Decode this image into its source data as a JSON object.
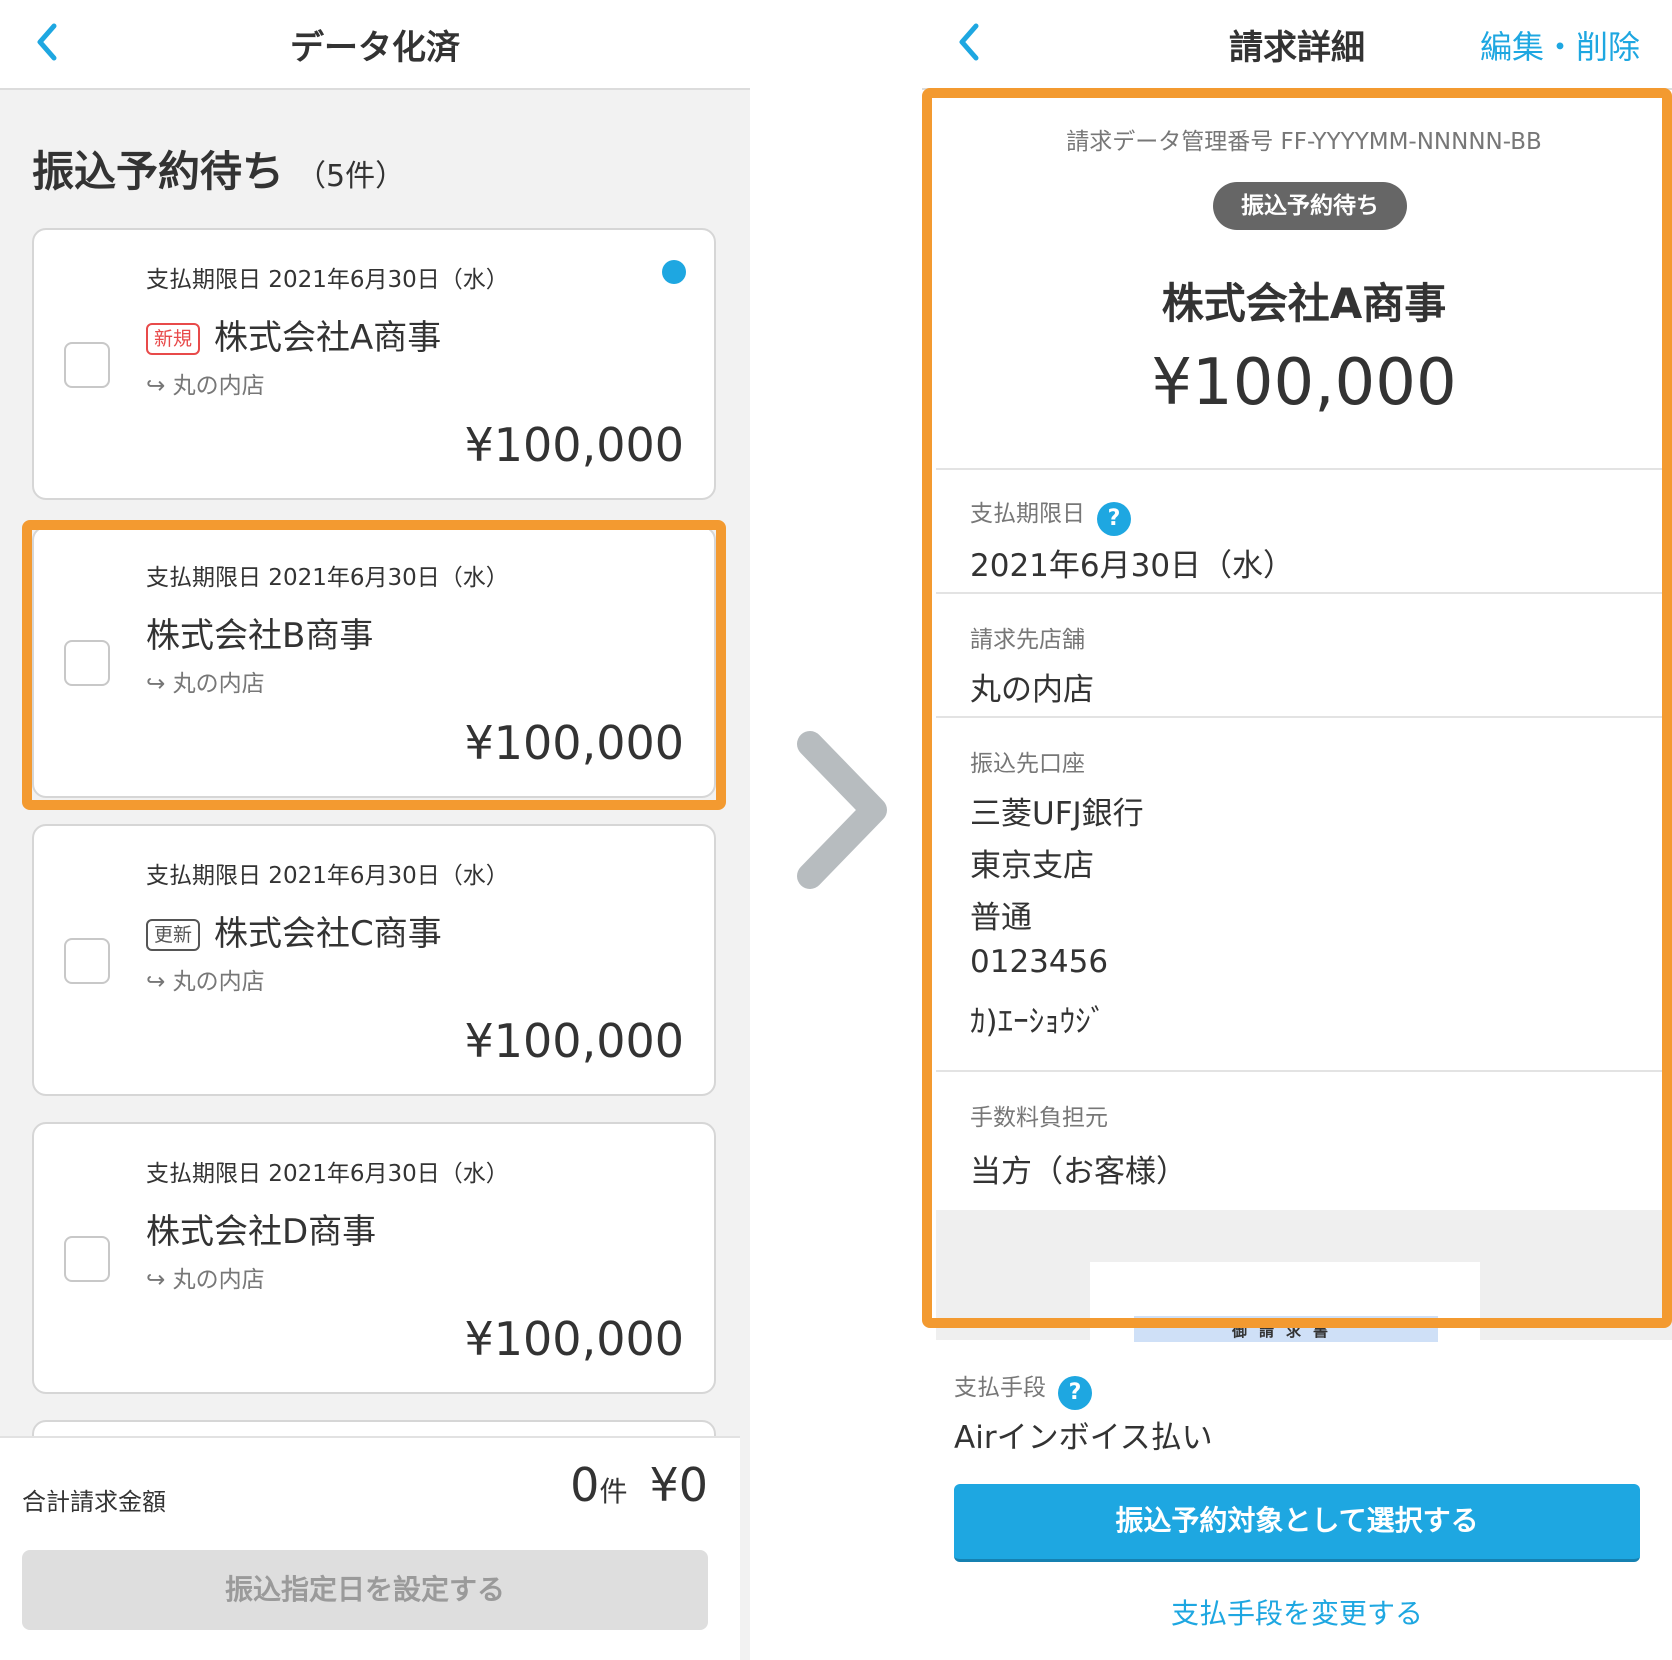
{
  "left": {
    "header_title": "データ化済",
    "section_title": "振込予約待ち",
    "section_count": "（5件）",
    "invoices": [
      {
        "due": "支払期限日 2021年6月30日（水）",
        "tag": "新規",
        "tag_type": "new",
        "company": "株式会社A商事",
        "branch": "丸の内店",
        "amount": "¥100,000",
        "unread": true
      },
      {
        "due": "支払期限日 2021年6月30日（水）",
        "tag": "",
        "tag_type": "",
        "company": "株式会社B商事",
        "branch": "丸の内店",
        "amount": "¥100,000",
        "unread": false
      },
      {
        "due": "支払期限日 2021年6月30日（水）",
        "tag": "更新",
        "tag_type": "upd",
        "company": "株式会社C商事",
        "branch": "丸の内店",
        "amount": "¥100,000",
        "unread": false
      },
      {
        "due": "支払期限日 2021年6月30日（水）",
        "tag": "",
        "tag_type": "",
        "company": "株式会社D商事",
        "branch": "丸の内店",
        "amount": "¥100,000",
        "unread": false
      }
    ],
    "footer": {
      "total_label": "合計請求金額",
      "total_count": "0",
      "total_count_unit": "件",
      "total_amount": "¥0",
      "button_label": "振込指定日を設定する"
    }
  },
  "right": {
    "header_title": "請求詳細",
    "edit_link": "編集・削除",
    "management_number": "請求データ管理番号 FF-YYYYMM-NNNNN-BB",
    "status": "振込予約待ち",
    "company": "株式会社A商事",
    "amount": "¥100,000",
    "fields": {
      "due_label": "支払期限日",
      "due_value": "2021年6月30日（水）",
      "store_label": "請求先店舗",
      "store_value": "丸の内店",
      "account_label": "振込先口座",
      "bank": "三菱UFJ銀行",
      "branch": "東京支店",
      "account_type": "普通",
      "account_number": "0123456",
      "account_holder": "ｶ)ｴｰｼｮｳｼﾞ",
      "fee_label": "手数料負担元",
      "fee_value": "当方（お客様）"
    },
    "preview_title": "御請求書",
    "payment_method_label": "支払手段",
    "payment_method_value": "Airインボイス払い",
    "primary_button": "振込予約対象として選択する",
    "change_link": "支払手段を変更する"
  },
  "colors": {
    "accent": "#1ea7e1",
    "highlight": "#f39a30",
    "new_tag": "#e84a4a",
    "status_badge": "#666666"
  }
}
